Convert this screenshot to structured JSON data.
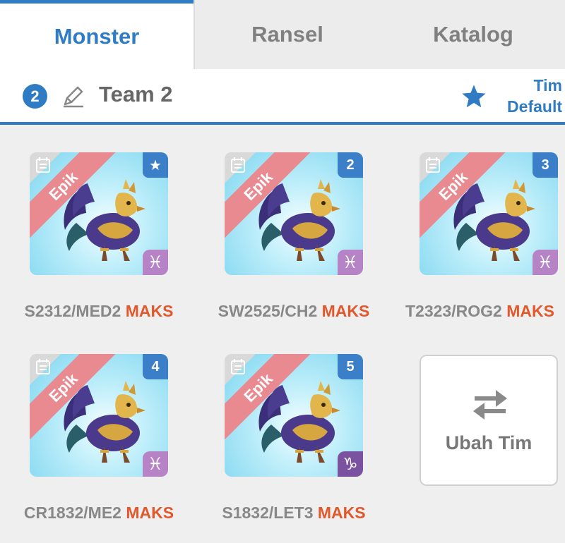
{
  "tabs": [
    {
      "label": "Monster",
      "active": true
    },
    {
      "label": "Ransel",
      "active": false
    },
    {
      "label": "Katalog",
      "active": false
    }
  ],
  "team": {
    "number": "2",
    "name": "Team 2",
    "default_line1": "Tim",
    "default_line2": "Default"
  },
  "monsters": [
    {
      "rarity": "Epik",
      "slot": "★",
      "code": "S2312/MED2",
      "level": "MAKS",
      "zodiac": "♓"
    },
    {
      "rarity": "Epik",
      "slot": "2",
      "code": "SW2525/CH2",
      "level": "MAKS",
      "zodiac": "♓"
    },
    {
      "rarity": "Epik",
      "slot": "3",
      "code": "T2323/ROG2",
      "level": "MAKS",
      "zodiac": "♓"
    },
    {
      "rarity": "Epik",
      "slot": "4",
      "code": "CR1832/ME2",
      "level": "MAKS",
      "zodiac": "♓"
    },
    {
      "rarity": "Epik",
      "slot": "5",
      "code": "S1832/LET3",
      "level": "MAKS",
      "zodiac": "♑"
    }
  ],
  "swap": {
    "label": "Ubah Tim",
    "icon": "swap-arrows-icon"
  },
  "colors": {
    "accent": "#2f7cc4",
    "maks": "#e2582b",
    "ribbon": "#e98990"
  }
}
